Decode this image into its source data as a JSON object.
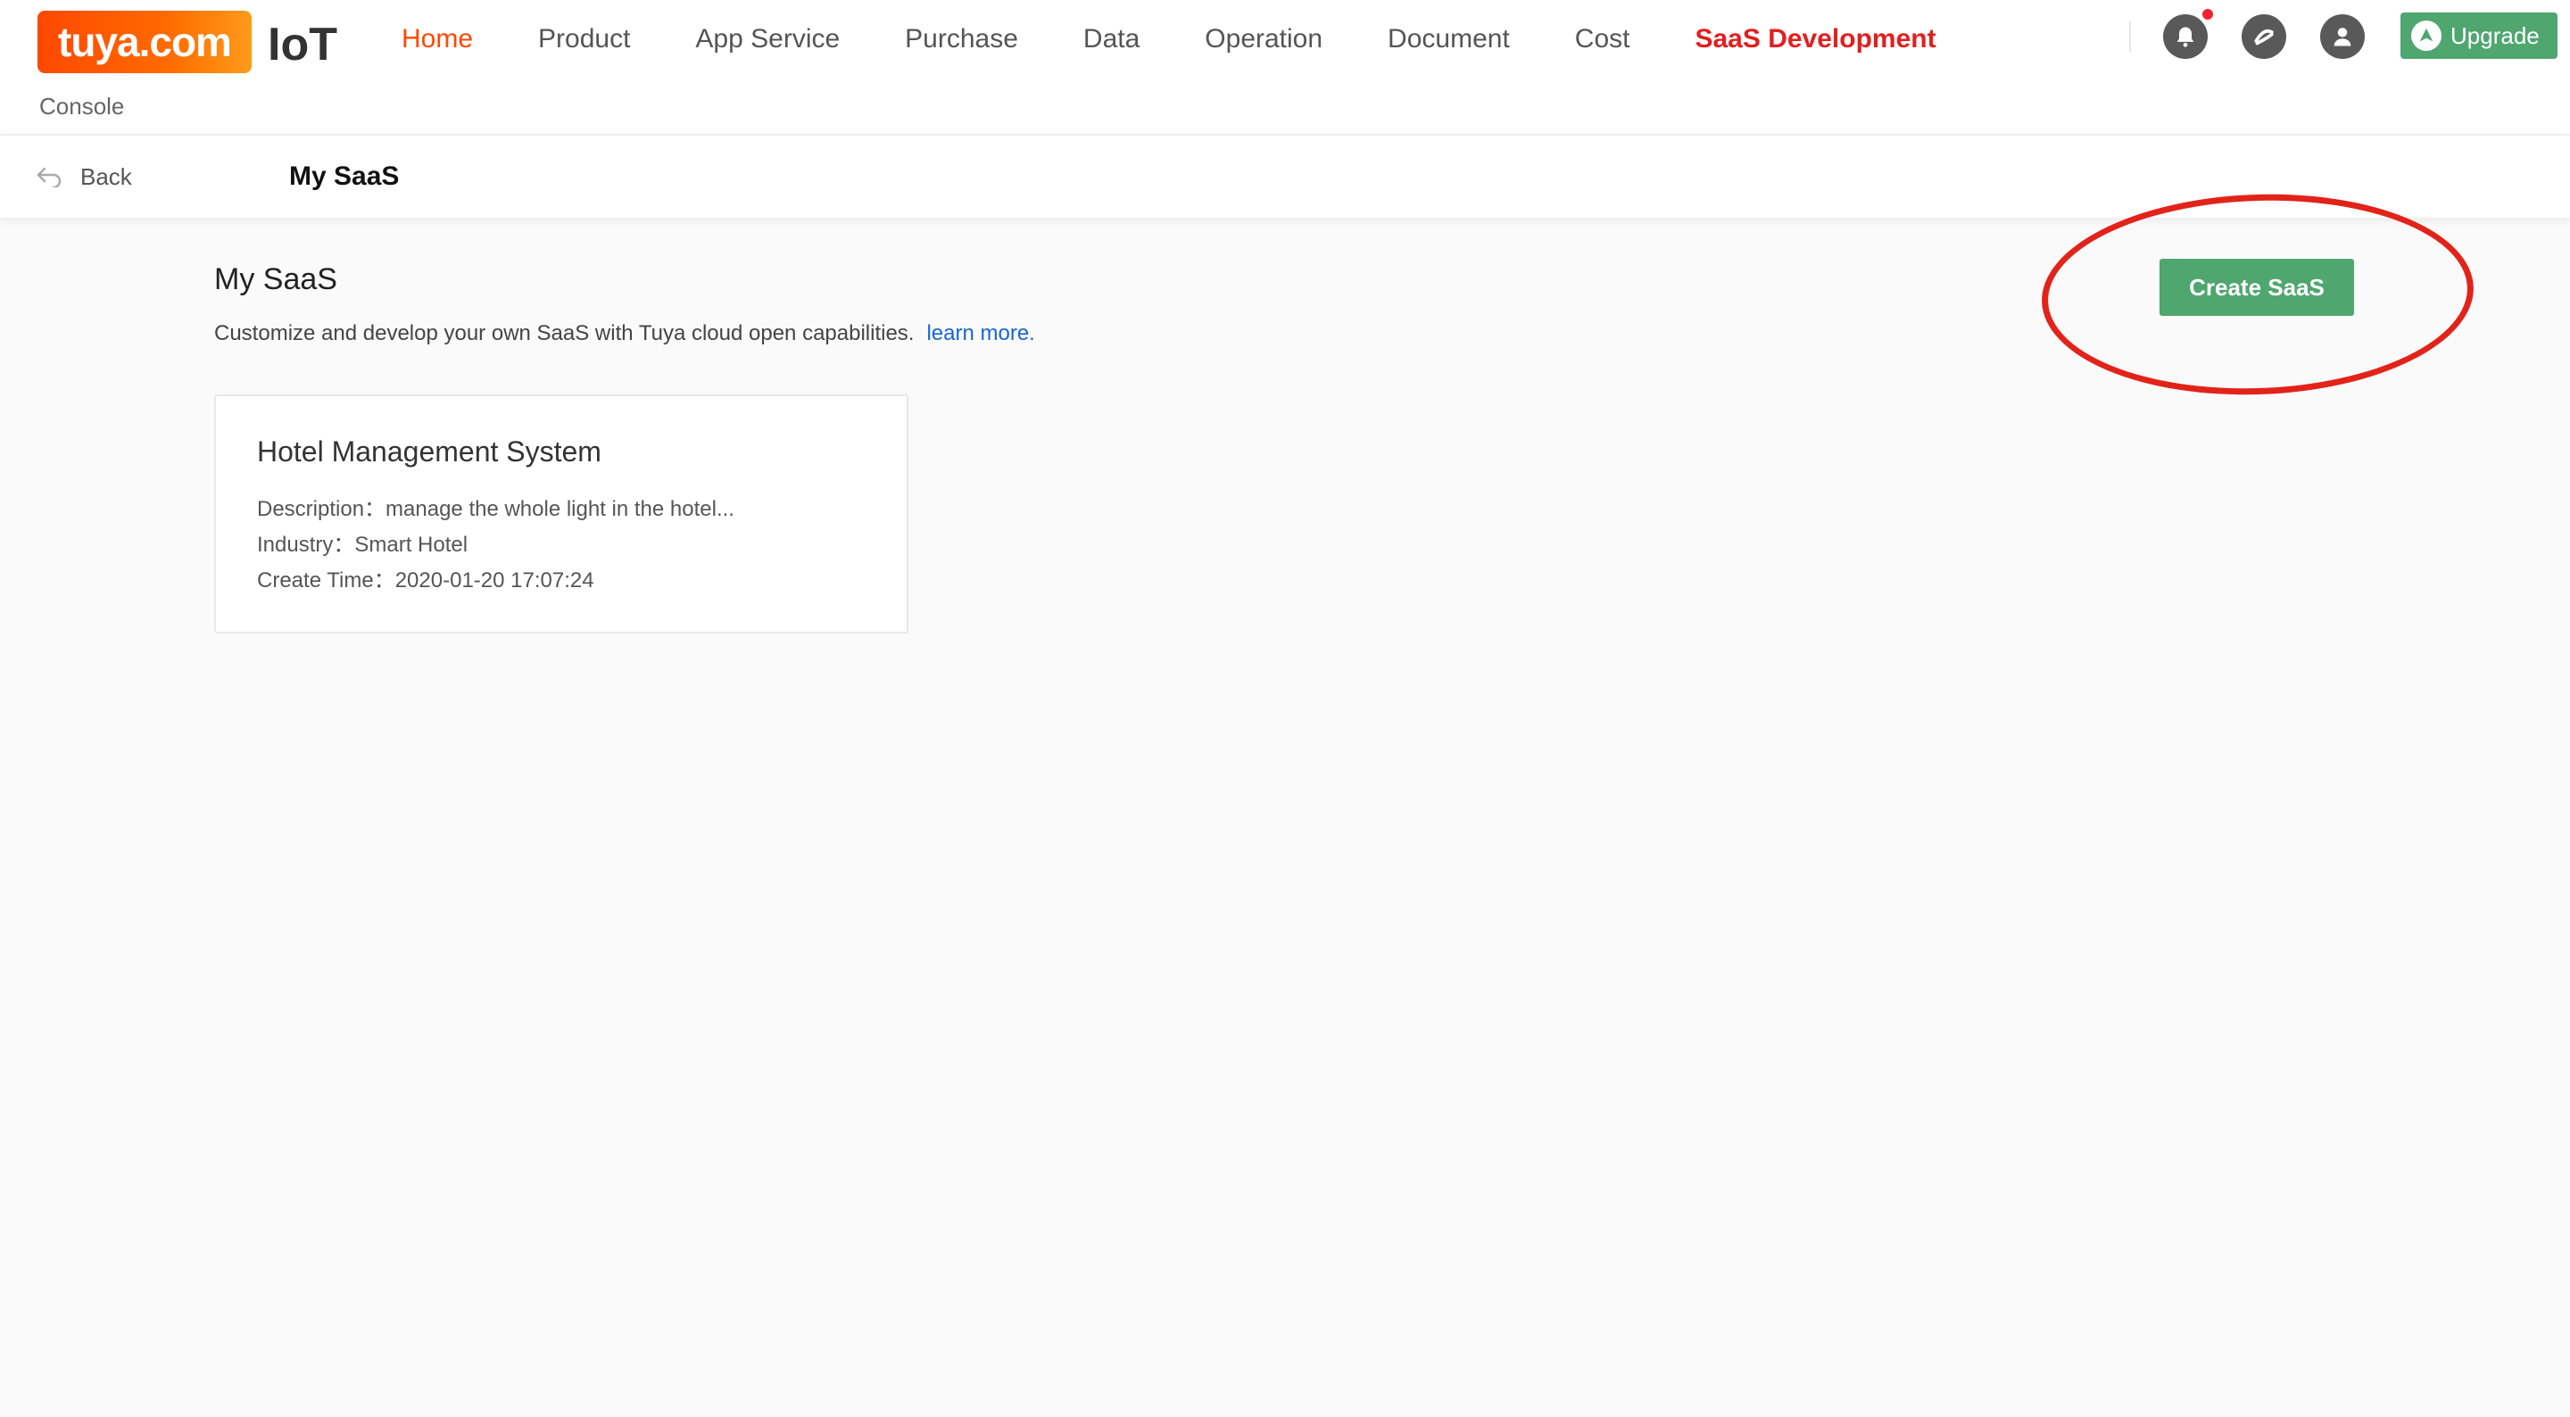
{
  "header": {
    "logo_text": "tuya.com",
    "logo_product": "IoT",
    "console_label": "Console",
    "nav": [
      {
        "label": "Home"
      },
      {
        "label": "Product"
      },
      {
        "label": "App Service"
      },
      {
        "label": "Purchase"
      },
      {
        "label": "Data"
      },
      {
        "label": "Operation"
      },
      {
        "label": "Document"
      },
      {
        "label": "Cost"
      },
      {
        "label": "SaaS Development"
      }
    ],
    "upgrade_label": "Upgrade"
  },
  "subbar": {
    "back_label": "Back",
    "title": "My SaaS"
  },
  "main": {
    "title": "My SaaS",
    "description": "Customize and develop your own SaaS with Tuya cloud open capabilities.",
    "learn_more": "learn more.",
    "create_button": "Create SaaS",
    "cards": [
      {
        "title": "Hotel Management System",
        "description": "Description：manage the whole light in the hotel...",
        "industry": "Industry：Smart Hotel",
        "create_time": "Create Time：2020-01-20 17:07:24"
      }
    ]
  },
  "colors": {
    "brand_orange": "#ff4800",
    "accent_green": "#4fa66f",
    "active_red": "#e02020",
    "link_blue": "#1766d4",
    "annotation_red": "#e2231a"
  },
  "icons": [
    "bell-icon",
    "globe-icon",
    "user-icon",
    "upgrade-arrow-icon",
    "back-arrow-icon"
  ]
}
